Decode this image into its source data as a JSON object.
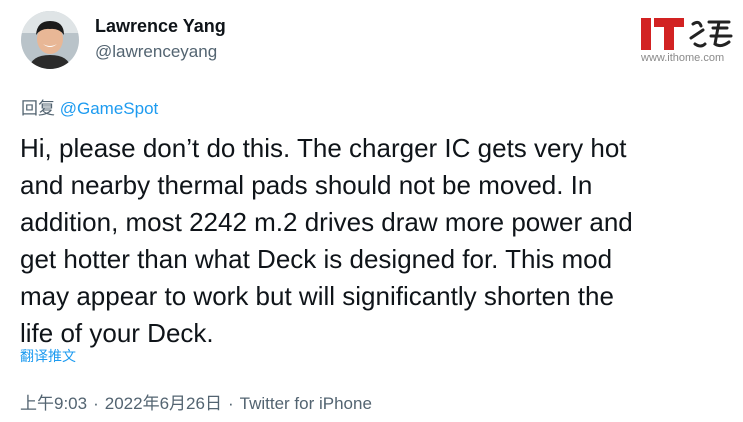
{
  "author": {
    "name": "Lawrence Yang",
    "handle": "@lawrenceyang"
  },
  "watermark": {
    "logo_text": "IT之家",
    "url": "www.ithome.com"
  },
  "reply": {
    "prefix": "回复",
    "mention": "@GameSpot"
  },
  "tweet": {
    "lines": [
      "Hi, please don’t do this. The charger IC gets very hot",
      "and nearby thermal pads should not be moved.  In",
      "addition, most 2242 m.2 drives draw more power and",
      "get hotter than what Deck is designed for. This mod",
      "may appear to work but will significantly shorten the",
      "life of your Deck."
    ],
    "translate_label": "翻译推文"
  },
  "meta": {
    "time": "上午9:03",
    "date": "2022年6月26日",
    "source": "Twitter for iPhone",
    "separator": "·"
  },
  "colors": {
    "text": "#0f1419",
    "secondary": "#536471",
    "link": "#1d9bf0",
    "logo_red": "#d22222"
  }
}
